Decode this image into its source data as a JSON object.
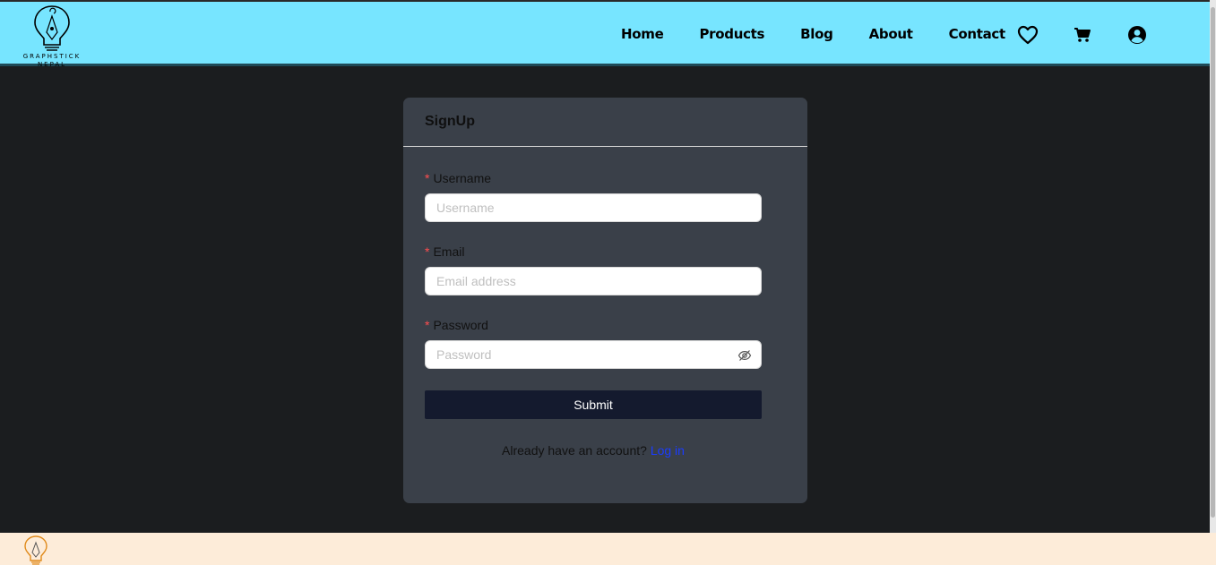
{
  "brand": {
    "logo_text_line1": "GRAPHSTICK",
    "logo_text_line2": "NEPAL"
  },
  "nav": {
    "items": [
      {
        "label": "Home"
      },
      {
        "label": "Products"
      },
      {
        "label": "Blog"
      },
      {
        "label": "About"
      },
      {
        "label": "Contact"
      }
    ],
    "icons": [
      "heart-icon",
      "cart-icon",
      "user-icon"
    ]
  },
  "signup": {
    "title": "SignUp",
    "fields": [
      {
        "label": "Username",
        "placeholder": "Username",
        "required": true,
        "value": ""
      },
      {
        "label": "Email",
        "placeholder": "Email address",
        "required": true,
        "value": ""
      },
      {
        "label": "Password",
        "placeholder": "Password",
        "required": true,
        "value": ""
      }
    ],
    "required_marker": "*",
    "submit_label": "Submit",
    "login_prompt": "Already have an account?",
    "login_link": "Log in"
  },
  "colors": {
    "navbar_bg": "#77e5ff",
    "page_bg": "#1b1d1f",
    "card_bg": "#3a4049",
    "submit_bg": "#141a2e",
    "link": "#1a3cff",
    "footer_bg": "#fdecd9"
  }
}
